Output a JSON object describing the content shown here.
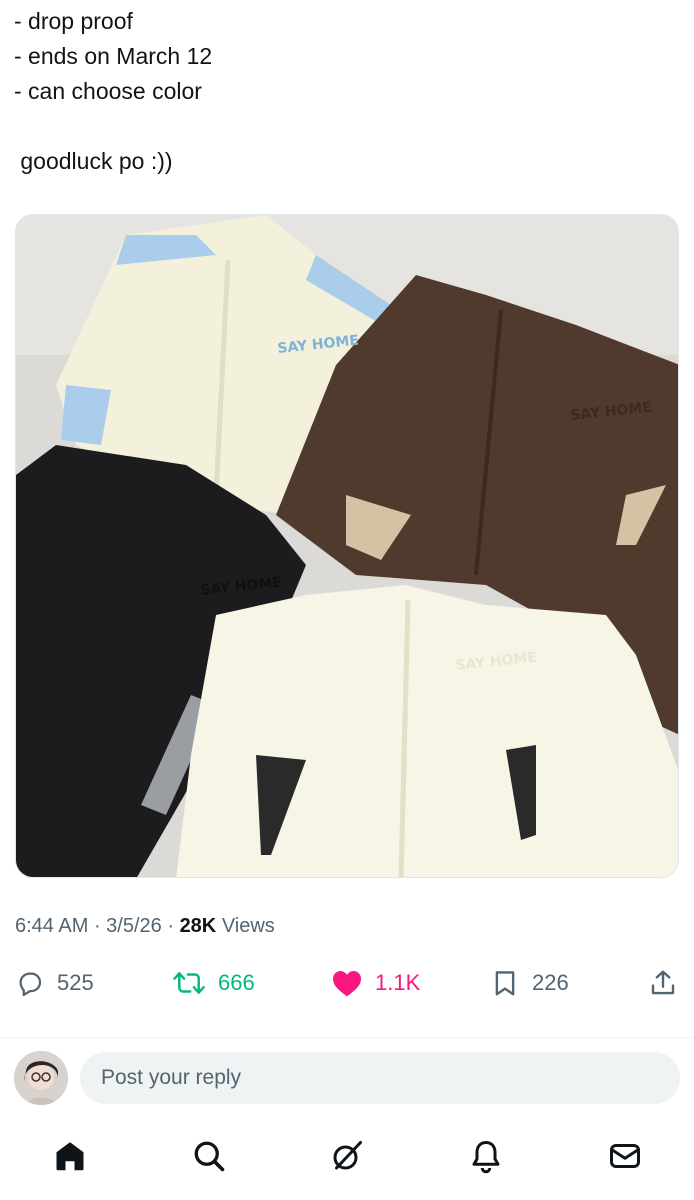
{
  "post": {
    "lines": [
      "- drop proof",
      "- ends on March 12",
      "- can choose color",
      "",
      " goodluck po :))"
    ]
  },
  "media": {
    "alt_description": "Four zip-up windbreaker jackets laid out: cream with light blue panels, brown, black, and cream with black panels, each with an embroidered logo",
    "logo_text": "SAY HOME"
  },
  "meta": {
    "time": "6:44 AM",
    "sep1": " · ",
    "date": "3/5/26",
    "sep2": " · ",
    "views_count": "28K",
    "views_label": " Views"
  },
  "actions": {
    "replies": "525",
    "reposts": "666",
    "likes": "1.1K",
    "bookmarks": "226"
  },
  "reply": {
    "placeholder": "Post your reply"
  },
  "tabs": [
    "home-icon",
    "search-icon",
    "grok-icon",
    "notifications-icon",
    "messages-icon"
  ],
  "colors": {
    "text": "#0f1419",
    "secondary": "#536471",
    "repost": "#00ba7c",
    "like": "#f91880",
    "input_bg": "#eff3f4"
  }
}
